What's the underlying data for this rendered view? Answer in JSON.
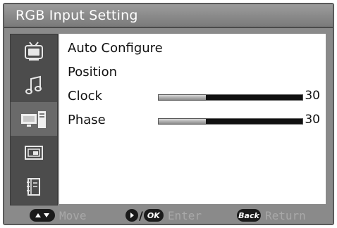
{
  "window": {
    "title": "RGB Input Setting"
  },
  "sidebar": {
    "items": [
      {
        "icon": "tv-icon"
      },
      {
        "icon": "music-note-icon"
      },
      {
        "icon": "monitor-icon"
      },
      {
        "icon": "picture-in-picture-icon"
      },
      {
        "icon": "settings-book-icon"
      }
    ],
    "active_index": 2
  },
  "menu": {
    "items": [
      {
        "label": "Auto Configure"
      },
      {
        "label": "Position"
      },
      {
        "label": "Clock",
        "value": "30",
        "level": 0.33
      },
      {
        "label": "Phase",
        "value": "30",
        "level": 0.33
      }
    ]
  },
  "footer": {
    "move_label": "Move",
    "enter_label": "Enter",
    "return_label": "Return",
    "ok_badge": "OK",
    "back_badge": "Back"
  },
  "colors": {
    "panel": "#8a8a8a",
    "sidebar": "#4c4c4c",
    "content": "#ffffff",
    "hint_text": "#a8a8a8"
  }
}
